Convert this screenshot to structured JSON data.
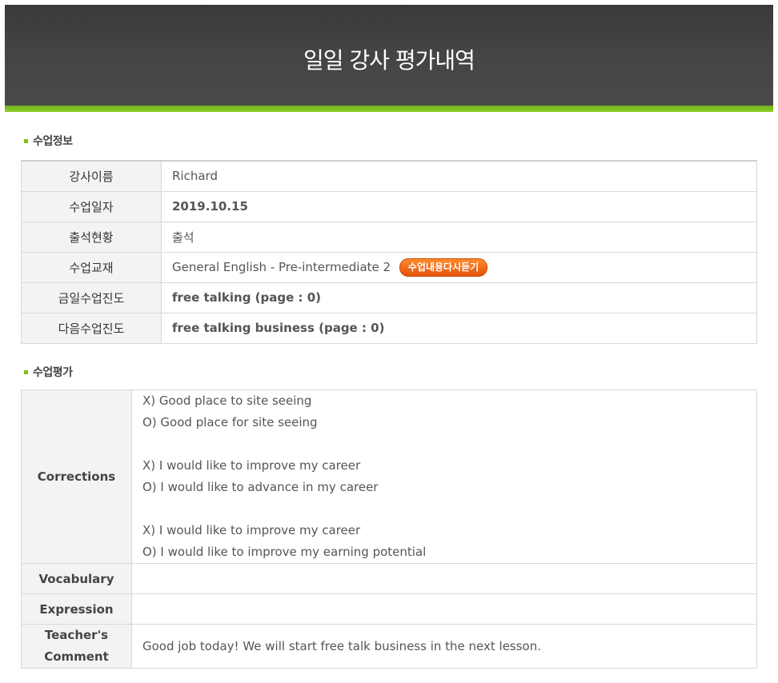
{
  "header": {
    "title": "일일 강사 평가내역"
  },
  "sections": {
    "class_info": "수업정보",
    "class_eval": "수업평가"
  },
  "class_info": {
    "rows": [
      {
        "label": "강사이름",
        "value": "Richard"
      },
      {
        "label": "수업일자",
        "value": "2019.10.15"
      },
      {
        "label": "출석현황",
        "value": "출석"
      },
      {
        "label": "수업교재",
        "value": "General English - Pre-intermediate 2"
      },
      {
        "label": "금일수업진도",
        "value": "free talking (page : 0)"
      },
      {
        "label": "다음수업진도",
        "value": "free talking business (page : 0)"
      }
    ],
    "replay_button": "수업내용다시듣기"
  },
  "class_eval": {
    "corrections_label": "Corrections",
    "corrections": [
      {
        "wrong": "X) Good place to site seeing",
        "right": "O) Good place for site seeing"
      },
      {
        "wrong": "X) I would like to improve my career",
        "right": "O) I would like to advance in my career"
      },
      {
        "wrong": "X) I would like to improve my career",
        "right": "O) I would like to improve my earning potential"
      }
    ],
    "vocabulary_label": "Vocabulary",
    "vocabulary": "",
    "expression_label": "Expression",
    "expression": "",
    "comment_label_line1": "Teacher's",
    "comment_label_line2": "Comment",
    "comment": "Good job today! We will start free talk business in the next lesson."
  },
  "colors": {
    "accent_green": "#7cbf1c",
    "progress_green": "#4e7c0c",
    "next_orange": "#e0701a",
    "button_orange": "#e3520a"
  }
}
